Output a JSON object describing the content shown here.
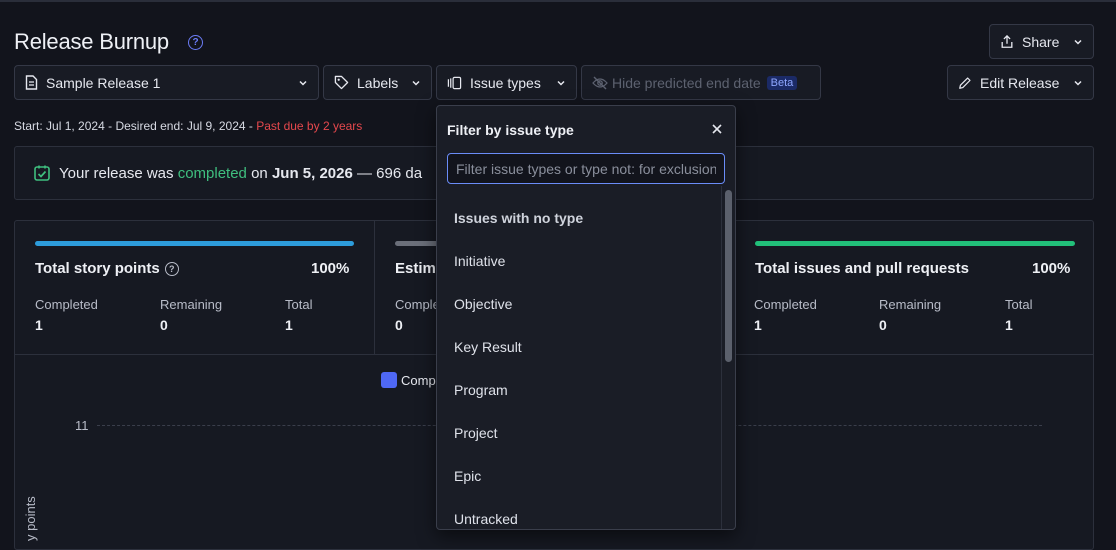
{
  "page": {
    "title": "Release Burnup",
    "share_label": "Share",
    "edit_label": "Edit Release"
  },
  "toolbar": {
    "release_name": "Sample Release 1",
    "labels_label": "Labels",
    "issue_types_label": "Issue types",
    "hide_predicted_label": "Hide predicted end date",
    "beta_label": "Beta"
  },
  "dates": {
    "start_key": "Start:",
    "start_val": "Jul 1, 2024",
    "sep": "-",
    "desired_key": "Desired end:",
    "desired_val": "Jul 9, 2024",
    "past_due": "Past due by 2 years"
  },
  "banner": {
    "prefix": "Your release was",
    "status": "completed",
    "on": "on",
    "date": "Jun 5, 2026",
    "suffix": "— 696 da"
  },
  "cards": [
    {
      "title": "Total story points",
      "percent": "100%",
      "bar_color": "#2d9cdb",
      "stats": [
        {
          "key": "Completed",
          "val": "1"
        },
        {
          "key": "Remaining",
          "val": "0"
        },
        {
          "key": "Total",
          "val": "1"
        }
      ]
    },
    {
      "title": "Estim",
      "bar_color": "#6b6f7a",
      "stats": [
        {
          "key": "Comple",
          "val": "0"
        }
      ]
    },
    {
      "title": "Total issues and pull requests",
      "percent": "100%",
      "bar_color": "#22c07a",
      "stats": [
        {
          "key": "Completed",
          "val": "1"
        },
        {
          "key": "Remaining",
          "val": "0"
        },
        {
          "key": "Total",
          "val": "1"
        }
      ]
    }
  ],
  "chart_data": {
    "type": "line",
    "series": [
      {
        "name": "Comp",
        "values": []
      }
    ],
    "yticks": [
      "11"
    ],
    "ylabel": "y points"
  },
  "dropdown": {
    "title": "Filter by issue type",
    "search_placeholder": "Filter issue types or type not: for exclusion",
    "items": [
      "Issues with no type",
      "Initiative",
      "Objective",
      "Key Result",
      "Program",
      "Project",
      "Epic",
      "Untracked"
    ]
  },
  "colors": {
    "accent": "#6b7cf6",
    "success": "#3fbf7f",
    "danger": "#e5484d",
    "legend": "#4f68f5"
  }
}
